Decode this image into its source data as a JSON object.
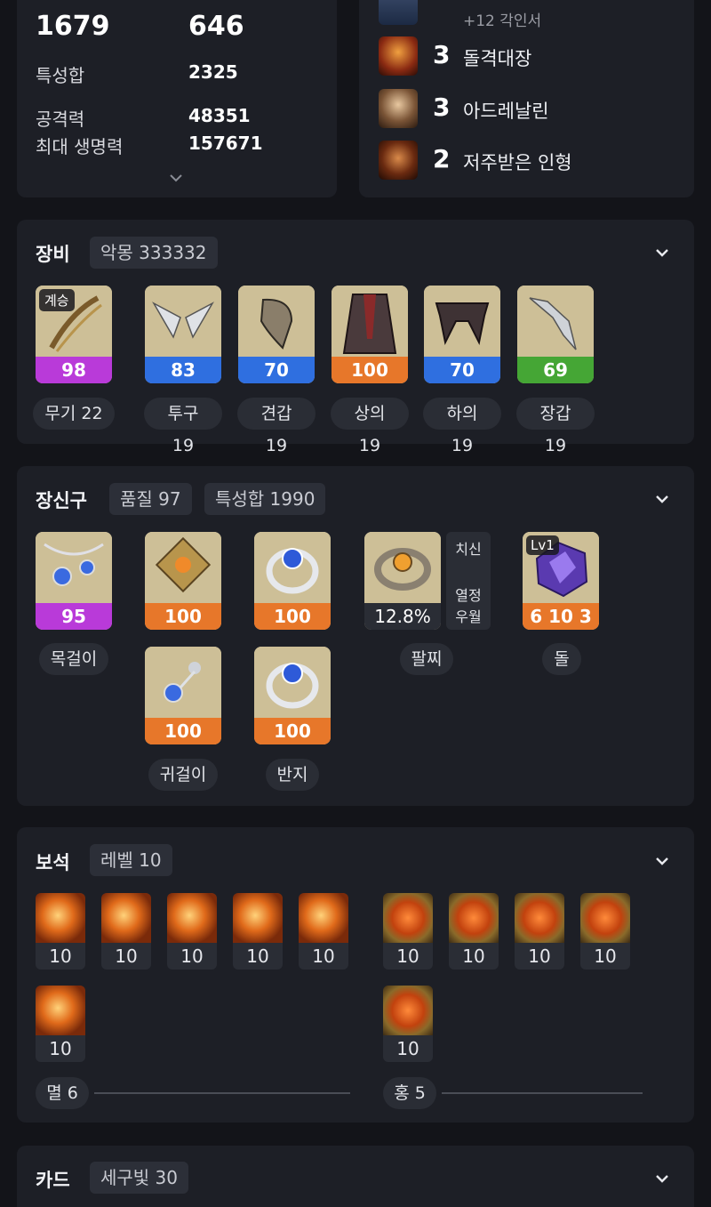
{
  "stats": {
    "top_left": "1679",
    "top_right": "646",
    "rows": [
      {
        "label": "특성합",
        "value": "2325"
      },
      {
        "label": "공격력",
        "value": "48351"
      },
      {
        "label": "최대 생명력",
        "value": "157671"
      }
    ]
  },
  "engravings": {
    "partial_text": "+12 각인서",
    "items": [
      {
        "level": "3",
        "name": "돌격대장"
      },
      {
        "level": "3",
        "name": "아드레날린"
      },
      {
        "level": "2",
        "name": "저주받은 인형"
      }
    ]
  },
  "equipment": {
    "title": "장비",
    "chip": "악몽 333332",
    "badge": "계승",
    "items": [
      {
        "quality": "98",
        "label": "무기 22",
        "color": "#b93ad9"
      },
      {
        "quality": "83",
        "label": "투구 19",
        "color": "#2f6fe0"
      },
      {
        "quality": "70",
        "label": "견갑 19",
        "color": "#2f6fe0"
      },
      {
        "quality": "100",
        "label": "상의 19",
        "color": "#e7772a"
      },
      {
        "quality": "70",
        "label": "하의 19",
        "color": "#2f6fe0"
      },
      {
        "quality": "69",
        "label": "장갑 19",
        "color": "#45a635"
      }
    ]
  },
  "accessories": {
    "title": "장신구",
    "chips": [
      "품질 97",
      "특성합 1990"
    ],
    "necklace": {
      "quality": "95",
      "label": "목걸이"
    },
    "earrings": {
      "qualities": [
        "100",
        "100"
      ],
      "label": "귀걸이"
    },
    "rings": {
      "qualities": [
        "100",
        "100"
      ],
      "label": "반지"
    },
    "bracelet": {
      "value": "12.8%",
      "label": "팔찌",
      "effects": [
        "치신",
        "열정",
        "우월"
      ]
    },
    "stone": {
      "level_badge": "Lv1",
      "value": "6 10 3",
      "label": "돌"
    }
  },
  "gems": {
    "title": "보석",
    "chip": "레벨 10",
    "left_values": [
      "10",
      "10",
      "10",
      "10",
      "10",
      "10"
    ],
    "right_values": [
      "10",
      "10",
      "10",
      "10",
      "10"
    ],
    "left_label": "멸 6",
    "right_label": "홍 5"
  },
  "cards": {
    "title": "카드",
    "chip": "세구빛 30"
  }
}
